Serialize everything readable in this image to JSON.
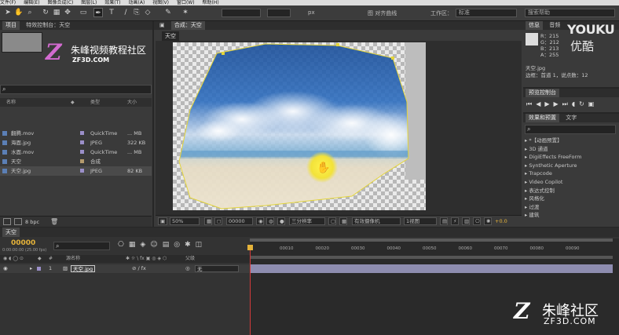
{
  "colors": {
    "accent": "#e5b33a",
    "label_blue": "#5b7fb5",
    "label_purple": "#9b8fc9",
    "label_tan": "#b59b6d",
    "playhead": "#d23a3a",
    "watermark_pink": "#d36bd0"
  },
  "menu": [
    "文件(F)",
    "编辑(E)",
    "图像合成(C)",
    "图层(L)",
    "效果(T)",
    "动画(A)",
    "视图(V)",
    "窗口(W)",
    "帮助(H)"
  ],
  "toolbar": {
    "px_value": "px",
    "align_label": "图 对齐曲线",
    "workspace_label": "工作区：",
    "workspace_value": "标准",
    "search_placeholder": "搜索帮助"
  },
  "project": {
    "tab_project": "项目",
    "tab_effects": "特效控制台：天空",
    "search_placeholder": "",
    "columns": {
      "name": "名称",
      "type": "类型",
      "size": "大小"
    },
    "rows": [
      {
        "name": "翻腾.mov",
        "type": "QuickTime",
        "size": "... MB",
        "color": "#9b8fc9",
        "icon": "film-icon"
      },
      {
        "name": "海面.jpg",
        "type": "JPEG",
        "size": "322 KB",
        "color": "#9b8fc9",
        "icon": "image-icon"
      },
      {
        "name": "水面.mov",
        "type": "QuickTime",
        "size": "... MB",
        "color": "#9b8fc9",
        "icon": "film-icon"
      },
      {
        "name": "天空",
        "type": "合成",
        "size": "",
        "color": "#b59b6d",
        "icon": "composition-icon"
      },
      {
        "name": "天空.jpg",
        "type": "JPEG",
        "size": "82 KB",
        "color": "#9b8fc9",
        "icon": "image-icon"
      }
    ],
    "bpc": "8 bpc"
  },
  "watermark": {
    "title": "朱峰视频教程社区",
    "site": "ZF3D.COM"
  },
  "comp": {
    "tab_label": "合成：天空",
    "crumb": "天空",
    "zoom": "50%",
    "timecode": "00000",
    "resolution": "三分辨率",
    "camera": "有效摄像机",
    "views": "1视图",
    "exposure": "+0.0"
  },
  "info": {
    "tab_info": "信息",
    "tab_audio": "音频",
    "r": "R：215",
    "g": "G：212",
    "b": "B：213",
    "a": "A：255",
    "layer": "天空.jpg",
    "detail": "边框：首道 1，说点数：12"
  },
  "preview": {
    "tab": "预览控制台"
  },
  "effects": {
    "tab": "效果和预置",
    "tab2": "文字",
    "search_placeholder": "",
    "items": [
      "*【动画预置】",
      "3D 通道",
      "DigiEffects FreeForm",
      "Synthetic Aperture",
      "Trapcode",
      "Video Copilot",
      "表达式控制",
      "风格化",
      "过渡",
      "建筑"
    ]
  },
  "timeline": {
    "tab": "天空",
    "timecode": "00000",
    "fps": "0:00:00:00 (25.00 fps)",
    "col_source": "源名称",
    "col_parent": "父级",
    "layer_index": "1",
    "layer_name": "天空.jpg",
    "parent_value": "无",
    "ruler": [
      "00010",
      "00020",
      "00030",
      "00040",
      "00050",
      "00060",
      "00070",
      "00080",
      "00090"
    ]
  },
  "youku": {
    "brand": "YOUKU",
    "sub": "优酷"
  },
  "brand_watermark": {
    "title": "朱峰社区",
    "site": "ZF3D.COM"
  }
}
